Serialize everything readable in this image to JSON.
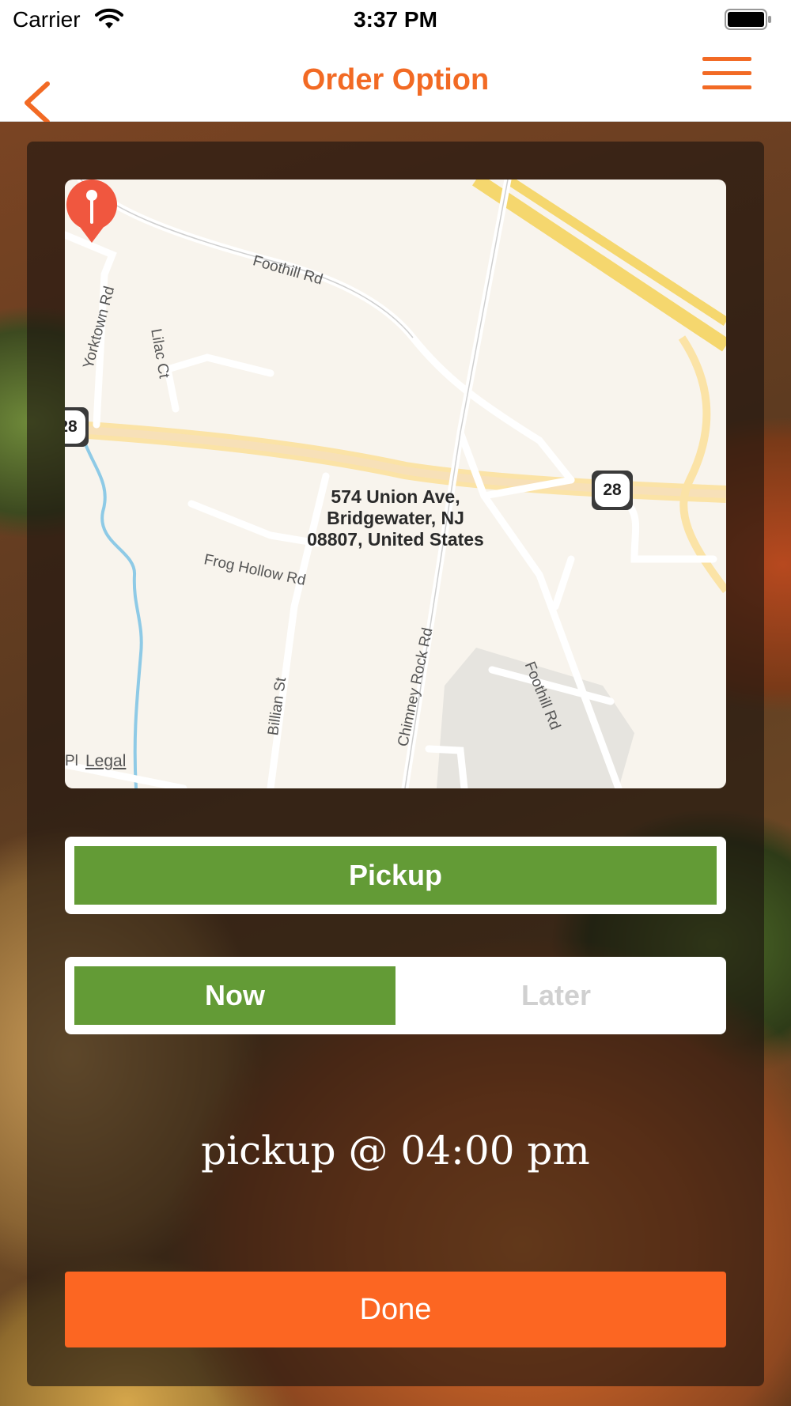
{
  "status_bar": {
    "carrier": "Carrier",
    "time": "3:37 PM",
    "wifi_icon": "wifi-icon",
    "battery_icon": "battery-full-icon"
  },
  "nav": {
    "title": "Order Option",
    "back_icon": "chevron-left-icon",
    "menu_icon": "hamburger-menu-icon"
  },
  "map": {
    "location_address_lines": [
      "574 Union Ave,",
      "Bridgewater, NJ",
      "08807, United States"
    ],
    "route_shields": [
      "28",
      "28"
    ],
    "street_labels": {
      "foothill_rd": "Foothill Rd",
      "yorktown_rd": "Yorktown Rd",
      "lilac_ct": "Lilac Ct",
      "frog_hollow_rd": "Frog Hollow Rd",
      "billian_st": "Billian St",
      "chimney_rock_rd": "Chimney Rock Rd",
      "foothill_rd_2": "Foothill Rd",
      "pl": "Pl"
    },
    "legal_label": "Legal",
    "pin_icon": "map-pin-icon"
  },
  "order_type": {
    "selected_label": "Pickup"
  },
  "timing": {
    "now_label": "Now",
    "later_label": "Later",
    "selected": "Now"
  },
  "pickup_summary": "pickup @ 04:00 pm",
  "done_label": "Done",
  "colors": {
    "accent_orange": "#f26a24",
    "done_orange": "#fc6622",
    "selected_green": "#639b36",
    "inactive_gray": "#d0d0d0"
  }
}
